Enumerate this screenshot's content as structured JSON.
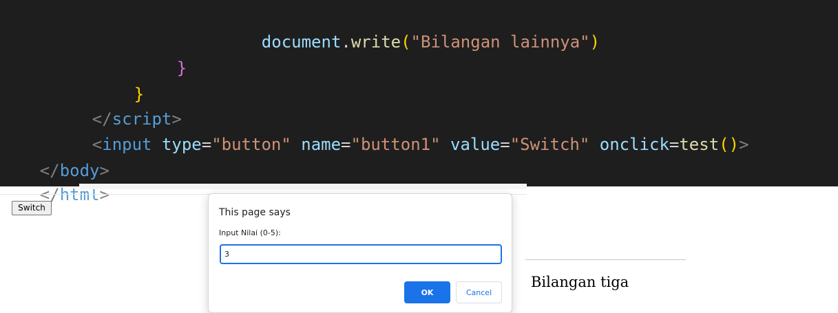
{
  "editor": {
    "line1": {
      "obj": "document",
      "dot": ".",
      "fn": "write",
      "open": "(",
      "str": "\"Bilangan lainnya\"",
      "close": ")"
    },
    "line2": {
      "brace": "}"
    },
    "line3": {
      "brace": "}"
    },
    "line4": {
      "lt": "</",
      "tag": "script",
      "gt": ">"
    },
    "line5": {
      "lt": "<",
      "tag": "input",
      "attr1": "type",
      "eq1": "=",
      "val1": "\"button\"",
      "attr2": "name",
      "eq2": "=",
      "val2": "\"button1\"",
      "attr3": "value",
      "eq3": "=",
      "val3": "\"Switch\"",
      "attr4": "onclick",
      "eq4": "=",
      "fn": "test",
      "parens": "()",
      "gt": ">"
    },
    "line6": {
      "lt": "</",
      "tag": "body",
      "gt": ">"
    },
    "line7": {
      "lt": "</",
      "tag": "html",
      "gt": ">"
    }
  },
  "page": {
    "switch_button": "Switch",
    "result_text": "Bilangan tiga"
  },
  "dialog": {
    "title": "This page says",
    "message": "Input Nilai (0-5):",
    "input_value": "3",
    "ok_label": "OK",
    "cancel_label": "Cancel"
  },
  "colors": {
    "editor_bg": "#1e1e1e",
    "tag": "#569cd6",
    "attribute": "#9cdcfe",
    "string": "#ce9178",
    "function": "#dcdcaa",
    "accent": "#1a73e8"
  }
}
